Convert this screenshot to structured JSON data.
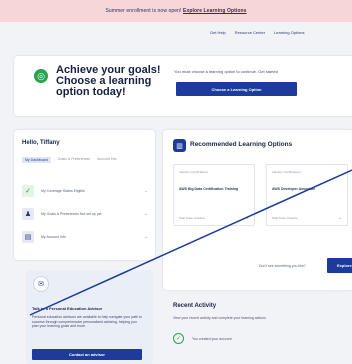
{
  "banner": {
    "text": "Summer enrollment is now open!",
    "link": "Explore Learning Options"
  },
  "topnav": [
    "Get Help",
    "Resource Center",
    "Learning Options"
  ],
  "goals": {
    "icon": "target-icon",
    "title": "Achieve your goals! Choose a learning option today!",
    "text": "You must choose a learning option to continue. Get started",
    "button": "Choose a Learning Option"
  },
  "welcome": {
    "title": "Hello, Tiffany",
    "tabs": [
      "My Dashboard",
      "Goals & Preferences",
      "Account Info"
    ],
    "rows": [
      {
        "icon": "gauge-icon",
        "text": "My Coverage Status Eligible",
        "color": "#2ba24e"
      },
      {
        "icon": "user-icon",
        "text": "My Goals & Preferences Not set up yet",
        "color": "#2a3a7c"
      },
      {
        "icon": "card-icon",
        "text": "My Account Info",
        "color": "#2a3a7c"
      }
    ]
  },
  "recommended": {
    "icon": "document-icon",
    "title": "Recommended Learning Options",
    "boxes": [
      {
        "label": "Industry Certifications",
        "name": "AWS Big Data Certification Training",
        "footer": "Start Date: Anytime"
      },
      {
        "label": "Industry Certifications",
        "name": "AWS Developer Associate",
        "footer": "Start Date: Anytime"
      }
    ],
    "question": "Don't see something you like?",
    "button": "Explore"
  },
  "advisor": {
    "icon": "chat-icon",
    "title": "Talk to a Personal Education Advisor",
    "text": "Personal education advisors are available to help navigate your path to success through comprehensive personalized advising, helping you plan your learning goals and more.",
    "button": "Contact an advisor"
  },
  "activity": {
    "title": "Recent Activity",
    "subtitle": "View your recent activity and complete your learning actions",
    "item": "You created your account"
  },
  "colors": {
    "primary": "#1c3b9a",
    "banner": "#f7d6da",
    "success": "#2ba24e"
  }
}
